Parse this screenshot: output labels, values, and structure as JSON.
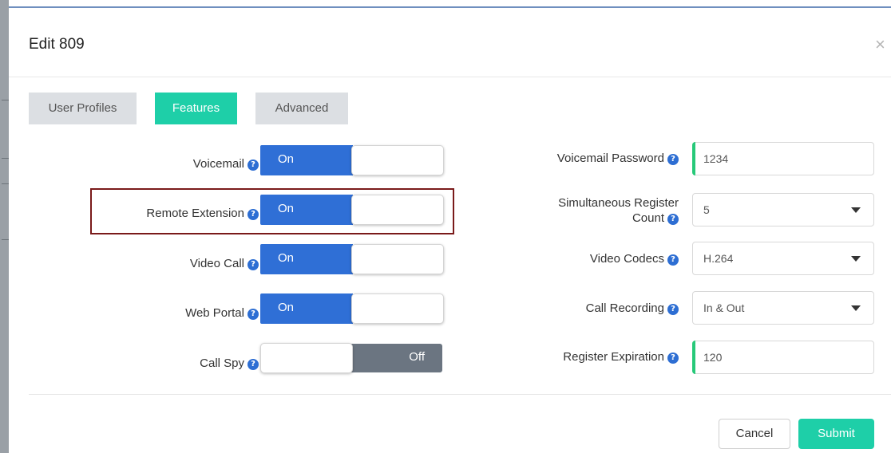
{
  "modal": {
    "title": "Edit 809",
    "close_glyph": "×"
  },
  "tabs": [
    {
      "label": "User Profiles",
      "active": false
    },
    {
      "label": "Features",
      "active": true
    },
    {
      "label": "Advanced",
      "active": false
    }
  ],
  "left_settings": [
    {
      "label": "Voicemail",
      "state": "On"
    },
    {
      "label": "Remote Extension",
      "state": "On"
    },
    {
      "label": "Video Call",
      "state": "On"
    },
    {
      "label": "Web Portal",
      "state": "On"
    },
    {
      "label": "Call Spy",
      "state": "Off"
    }
  ],
  "right_settings": {
    "voicemail_password": {
      "label": "Voicemail Password",
      "value": "1234"
    },
    "simultaneous_register_count": {
      "label_line1": "Simultaneous Register",
      "label_line2": "Count",
      "value": "5"
    },
    "video_codecs": {
      "label": "Video Codecs",
      "value": "H.264"
    },
    "call_recording": {
      "label": "Call Recording",
      "value": "In & Out"
    },
    "register_expiration": {
      "label": "Register Expiration",
      "value": "120"
    }
  },
  "help_glyph": "?",
  "footer": {
    "cancel_label": "Cancel",
    "submit_label": "Submit"
  },
  "colors": {
    "accent": "#1ecfa8",
    "toggle_on": "#2f6fd6",
    "toggle_off": "#6b7581",
    "highlight": "#7a1a1a",
    "text_field_marker": "#27c979"
  }
}
